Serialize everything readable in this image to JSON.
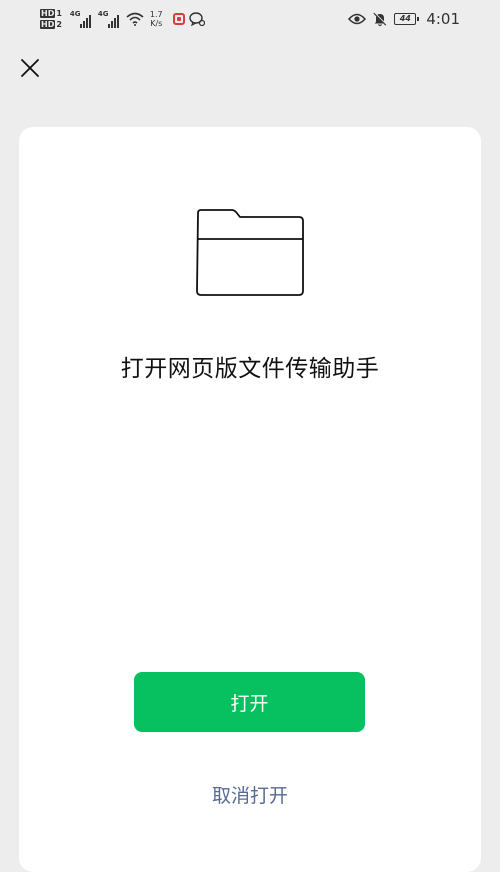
{
  "status_bar": {
    "hd_badges": [
      {
        "label": "HD",
        "index": "1"
      },
      {
        "label": "HD",
        "index": "2"
      }
    ],
    "signals": [
      {
        "tech": "4G",
        "level": 4
      },
      {
        "tech": "4G",
        "level": 4
      }
    ],
    "speed_value": "1.7",
    "speed_unit": "K/s",
    "battery_level": "44",
    "time": "4:01"
  },
  "dialog": {
    "title": "打开网页版文件传输助手",
    "open_label": "打开",
    "cancel_label": "取消打开"
  },
  "colors": {
    "background": "#ededed",
    "sheet": "#ffffff",
    "primary_button": "#07c160",
    "link": "#576b95"
  },
  "icons": {
    "close": "close-icon",
    "folder": "folder-icon"
  }
}
